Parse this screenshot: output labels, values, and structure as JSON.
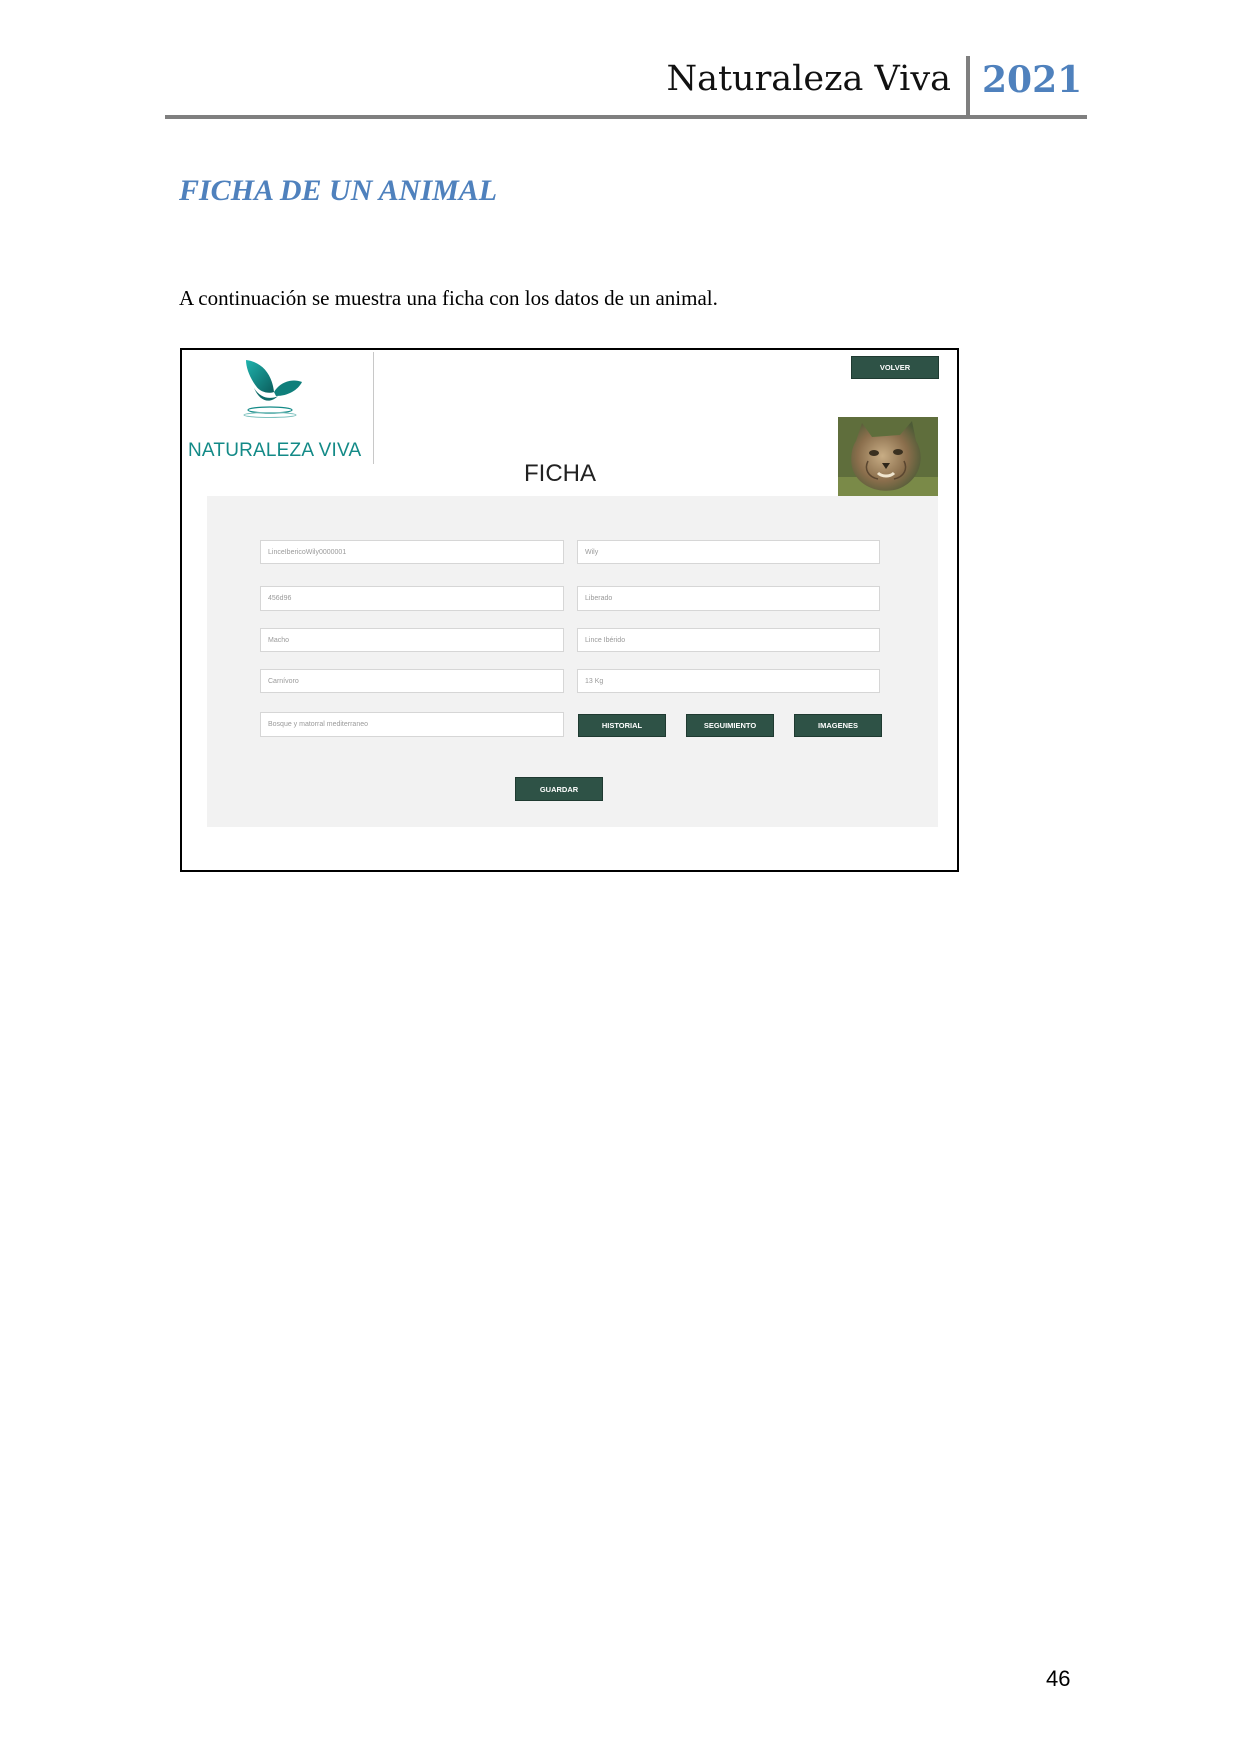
{
  "header": {
    "title": "Naturaleza Viva",
    "year": "2021"
  },
  "section_heading": "FICHA DE UN ANIMAL",
  "intro_text": "A continuación se muestra una ficha con los datos de un animal.",
  "screenshot": {
    "logo_text": "NATURALEZA VIVA",
    "volver_label": "VOLVER",
    "form_title": "FICHA",
    "fields": [
      {
        "placeholder": "LinceIbericoWily0000001"
      },
      {
        "placeholder": "Wily"
      },
      {
        "placeholder": "456d96"
      },
      {
        "placeholder": "Liberado"
      },
      {
        "placeholder": "Macho"
      },
      {
        "placeholder": "Lince Ibérido"
      },
      {
        "placeholder": "Carnívoro"
      },
      {
        "placeholder": "13 Kg"
      },
      {
        "placeholder": "Bosque y matorral mediterraneo"
      }
    ],
    "buttons": {
      "historial": "HISTORIAL",
      "seguimiento": "SEGUIMIENTO",
      "imagenes": "IMAGENES",
      "guardar": "GUARDAR"
    },
    "colors": {
      "button_bg": "#2e5246",
      "logo_teal": "#138a87",
      "panel_bg": "#f2f2f2"
    }
  },
  "page_number": "46"
}
